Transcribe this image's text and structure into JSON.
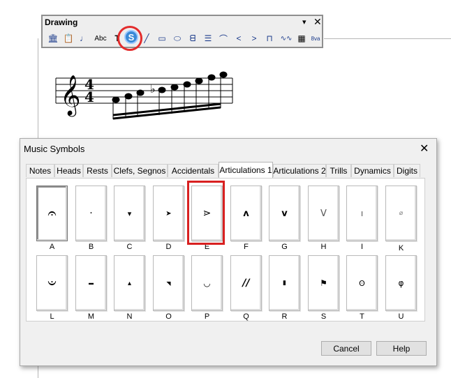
{
  "toolbar": {
    "title": "Drawing",
    "dropdown_glyph": "▾",
    "close_glyph": "✕",
    "icons": [
      {
        "name": "library-icon",
        "glyph": "🏛"
      },
      {
        "name": "clipboard-icon",
        "glyph": "📋"
      },
      {
        "name": "note-tool-icon",
        "glyph": "♩"
      },
      {
        "name": "spellcheck-icon",
        "glyph": "Abc"
      },
      {
        "name": "text-tool-icon",
        "glyph": "T"
      },
      {
        "name": "symbol-tool-icon",
        "glyph": "S"
      },
      {
        "name": "line-tool-icon",
        "glyph": "╱"
      },
      {
        "name": "rectangle-tool-icon",
        "glyph": "▭"
      },
      {
        "name": "ellipse-tool-icon",
        "glyph": "⬭"
      },
      {
        "name": "polygon-tool-icon",
        "glyph": "ᗺ"
      },
      {
        "name": "staff-lines-icon",
        "glyph": "☰"
      },
      {
        "name": "slur-icon",
        "glyph": "⌒"
      },
      {
        "name": "crescendo-icon",
        "glyph": "<"
      },
      {
        "name": "decrescendo-icon",
        "glyph": ">"
      },
      {
        "name": "bracket-icon",
        "glyph": "⊓"
      },
      {
        "name": "trill-line-icon",
        "glyph": "∿∿"
      },
      {
        "name": "grid-icon",
        "glyph": "▦"
      },
      {
        "name": "ottava-icon",
        "glyph": "8va"
      }
    ]
  },
  "staff": {
    "clef": "𝄞",
    "time_signature": {
      "top": "4",
      "bottom": "4"
    },
    "flat": "♭"
  },
  "dialog": {
    "title": "Music Symbols",
    "close_glyph": "✕",
    "tabs": [
      {
        "label": "Notes"
      },
      {
        "label": "Heads"
      },
      {
        "label": "Rests"
      },
      {
        "label": "Clefs, Segnos"
      },
      {
        "label": "Accidentals"
      },
      {
        "label": "Articulations 1",
        "active": true
      },
      {
        "label": "Articulations 2"
      },
      {
        "label": "Trills"
      },
      {
        "label": "Dynamics"
      },
      {
        "label": "Digits"
      }
    ],
    "symbols": [
      {
        "label": "A",
        "glyph": "𝄐",
        "selected": true
      },
      {
        "label": "B",
        "glyph": "·"
      },
      {
        "label": "C",
        "glyph": "▾"
      },
      {
        "label": "D",
        "glyph": "➤"
      },
      {
        "label": "E",
        "glyph": "⋗",
        "highlighted": true
      },
      {
        "label": "F",
        "glyph": "ʌ"
      },
      {
        "label": "G",
        "glyph": "v"
      },
      {
        "label": "H",
        "glyph": "V"
      },
      {
        "label": "I",
        "glyph": "ı"
      },
      {
        "label": "K",
        "glyph": "⌀"
      },
      {
        "label": "L",
        "glyph": "𝄑"
      },
      {
        "label": "M",
        "glyph": "–"
      },
      {
        "label": "N",
        "glyph": "▴"
      },
      {
        "label": "O",
        "glyph": "◥"
      },
      {
        "label": "P",
        "glyph": "◡"
      },
      {
        "label": "Q",
        "glyph": "//"
      },
      {
        "label": "R",
        "glyph": "▮"
      },
      {
        "label": "S",
        "glyph": "⚑"
      },
      {
        "label": "T",
        "glyph": "ʘ"
      },
      {
        "label": "U",
        "glyph": "φ"
      }
    ],
    "buttons": {
      "cancel": "Cancel",
      "help": "Help"
    }
  },
  "colors": {
    "highlight": "#d82020",
    "symbol_icon": "#3a8ad6"
  }
}
